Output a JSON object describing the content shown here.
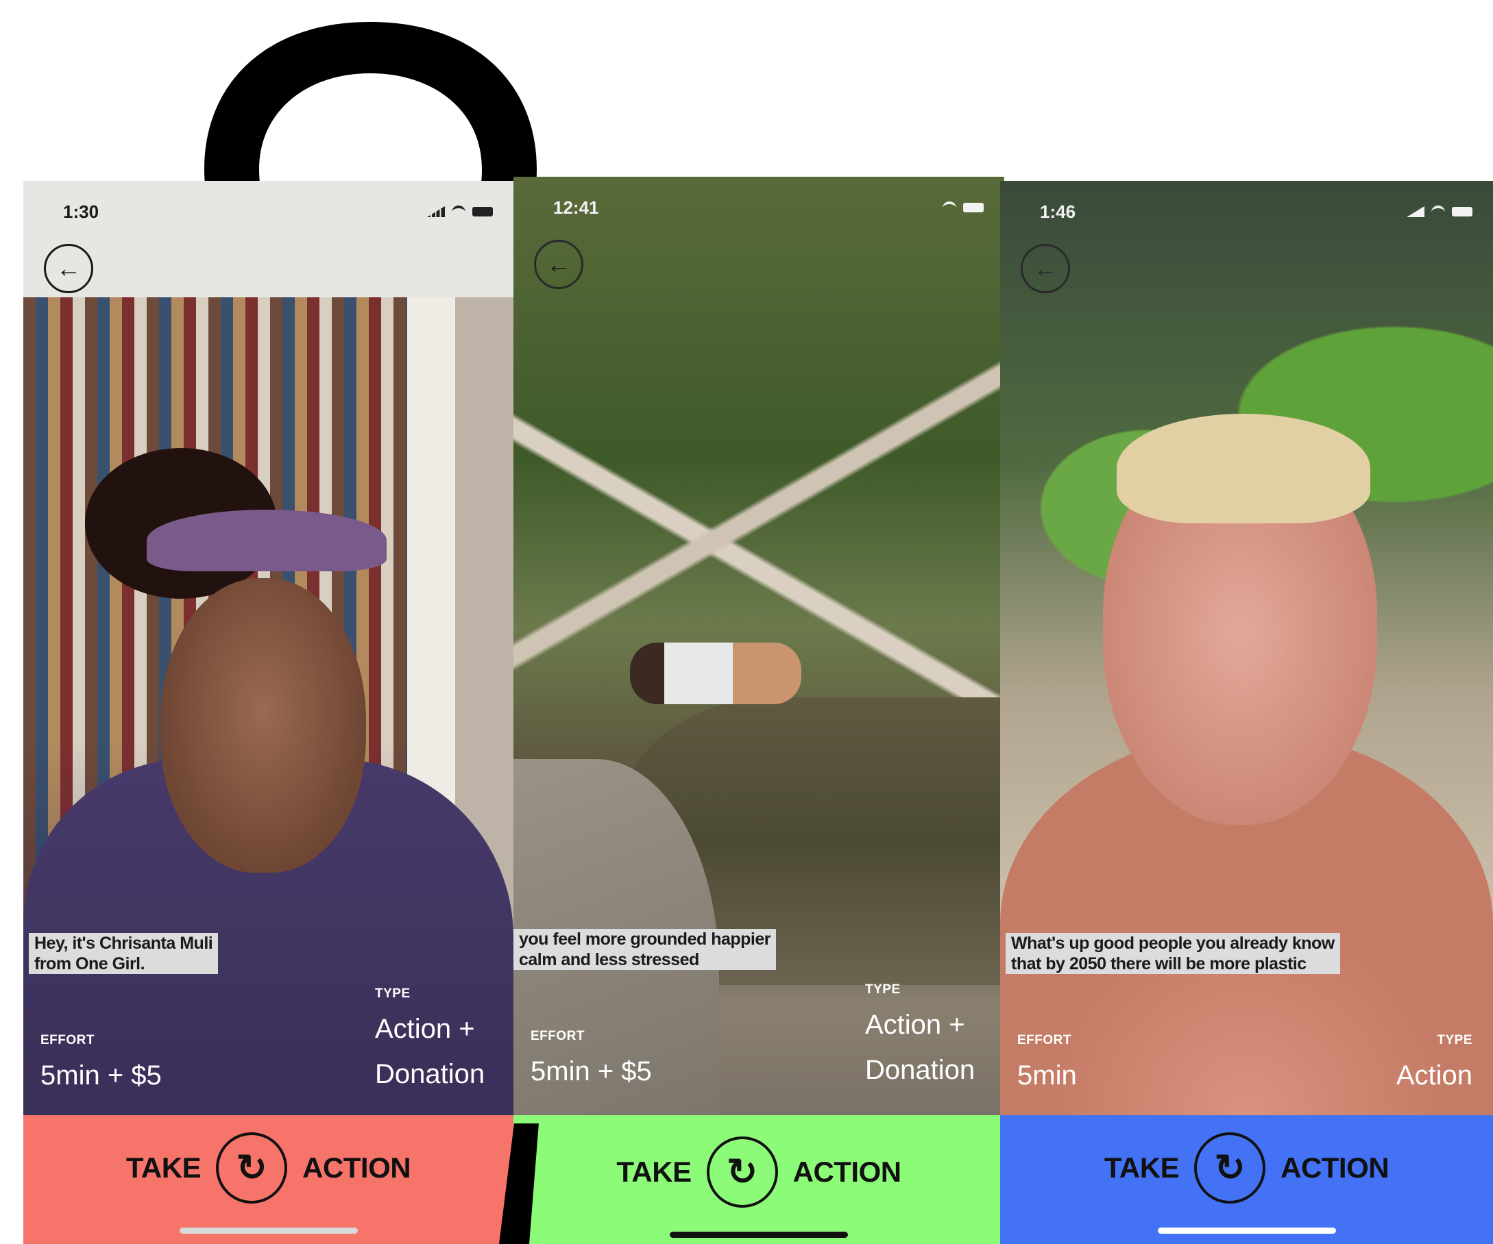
{
  "screens": [
    {
      "time": "1:30",
      "caption": [
        "Hey, it's Chrisanta Muli",
        "from One Girl."
      ],
      "effort_label": "EFFORT",
      "effort_value": "5min + $5",
      "type_label": "TYPE",
      "type_value": [
        "Action +",
        "Donation"
      ],
      "action_left": "TAKE",
      "action_right": "ACTION",
      "action_color": "#f7746a",
      "home_indicator_color": "#d9d9d9"
    },
    {
      "time": "12:41",
      "caption": [
        "you feel more grounded happier",
        "calm and less stressed"
      ],
      "effort_label": "EFFORT",
      "effort_value": "5min + $5",
      "type_label": "TYPE",
      "type_value": [
        "Action +",
        "Donation"
      ],
      "action_left": "TAKE",
      "action_right": "ACTION",
      "action_color": "#8cfb77",
      "home_indicator_color": "#111111"
    },
    {
      "time": "1:46",
      "caption": [
        "What's up good people you already know",
        "that by 2050 there will be more plastic"
      ],
      "effort_label": "EFFORT",
      "effort_value": "5min",
      "type_label": "TYPE",
      "type_value": "Action",
      "action_left": "TAKE",
      "action_right": "ACTION",
      "action_color": "#4372f5",
      "home_indicator_color": "#ffffff"
    }
  ],
  "icons": {
    "back": "arrow-left-icon",
    "logo": "take-action-logo-icon"
  }
}
